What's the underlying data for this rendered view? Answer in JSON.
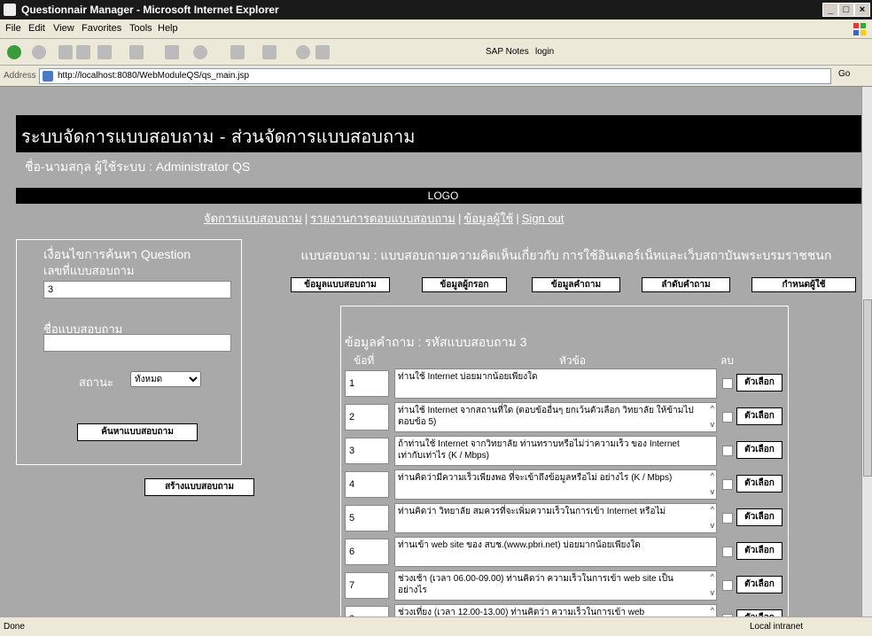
{
  "window": {
    "title": "Questionnair Manager - Microsoft Internet Explorer"
  },
  "menu": [
    "File",
    "Edit",
    "View",
    "Favorites",
    "Tools",
    "Help"
  ],
  "toolbar": {
    "links": [
      "SAP Notes",
      "login"
    ]
  },
  "address": {
    "label": "Address",
    "url": "http://localhost:8080/WebModuleQS/qs_main.jsp",
    "go_label": "Go"
  },
  "page": {
    "header": "ระบบจัดการแบบสอบถาม - ส่วนจัดการแบบสอบถาม",
    "user_line": "ชื่อ-นามสกุล ผู้ใช้ระบบ : Administrator QS",
    "logo": "LOGO",
    "nav": [
      "จัดการแบบสอบถาม",
      "รายงานการตอบแบบสอบถาม",
      "ข้อมูลผู้ใช้",
      "Sign out"
    ]
  },
  "search": {
    "heading": "เงื่อนไขการค้นหา Question",
    "number_label": "เลขที่แบบสอบถาม",
    "number_value": "3",
    "name_label": "ชื่อแบบสอบถาม",
    "name_value": "",
    "status_label": "สถานะ",
    "status_value": "ทั้งหมด",
    "search_button": "ค้นหาแบบสอบถาม"
  },
  "create_button": "สร้างแบบสอบถาม",
  "questionnaire": {
    "title": "แบบสอบถาม : แบบสอบถามความคิดเห็นเกี่ยวกับ การใช้อินเตอร์เน็ทและเว็บสถาบันพระบรมราชชนก",
    "tabs": [
      "ข้อมูลแบบสอบถาม",
      "ข้อมูลผู้กรอก",
      "ข้อมูลคำถาม",
      "ลำดับคำถาม",
      "กำหนดผู้ใช้"
    ]
  },
  "questions": {
    "heading": "ข้อมูลคำถาม : รหัสแบบสอบถาม 3",
    "col_no": "ข้อที่",
    "col_topic": "หัวข้อ",
    "col_delete": "ลบ",
    "option_button": "ตัวเลือก",
    "rows": [
      {
        "no": "1",
        "text": "ท่านใช้ Internet บ่อยมากน้อยเพียงใด",
        "scroll": false
      },
      {
        "no": "2",
        "text": "ท่านใช้ Internet จากสถานที่ใด (ตอบข้ออื่นๆ ยกเว้นตัวเลือก วิทยาลัย ให้ข้ามไปตอบข้อ 5)",
        "scroll": true
      },
      {
        "no": "3",
        "text": "ถ้าท่านใช้ Internet จากวิทยาลัย ท่านทราบหรือไม่ว่าความเร็ว ของ Internet เท่ากับเท่าไร (K / Mbps)",
        "scroll": false
      },
      {
        "no": "4",
        "text": "ท่านคิดว่ามีความเร็วเพียงพอ ที่จะเข้าถึงข้อมูลหรือไม่ อย่างไร (K / Mbps)",
        "scroll": true
      },
      {
        "no": "5",
        "text": "ท่านคิดว่า วิทยาลัย สมควรที่จะเพิ่มความเร็วในการเข้า Internet หรือไม่",
        "scroll": true
      },
      {
        "no": "6",
        "text": "ท่านเข้า web site ของ สบช.(www.pbri.net) บ่อยมากน้อยเพียงใด",
        "scroll": false
      },
      {
        "no": "7",
        "text": "ช่วงเช้า (เวลา 06.00-09.00) ท่านคิดว่า ความเร็วในการเข้า web site เป็นอย่างไร",
        "scroll": true
      },
      {
        "no": "8",
        "text": "ช่วงเที่ยง (เวลา 12.00-13.00) ท่านคิดว่า ความเร็วในการเข้า web",
        "scroll": true
      }
    ]
  },
  "status": {
    "left": "Done",
    "zone": "Local intranet"
  }
}
